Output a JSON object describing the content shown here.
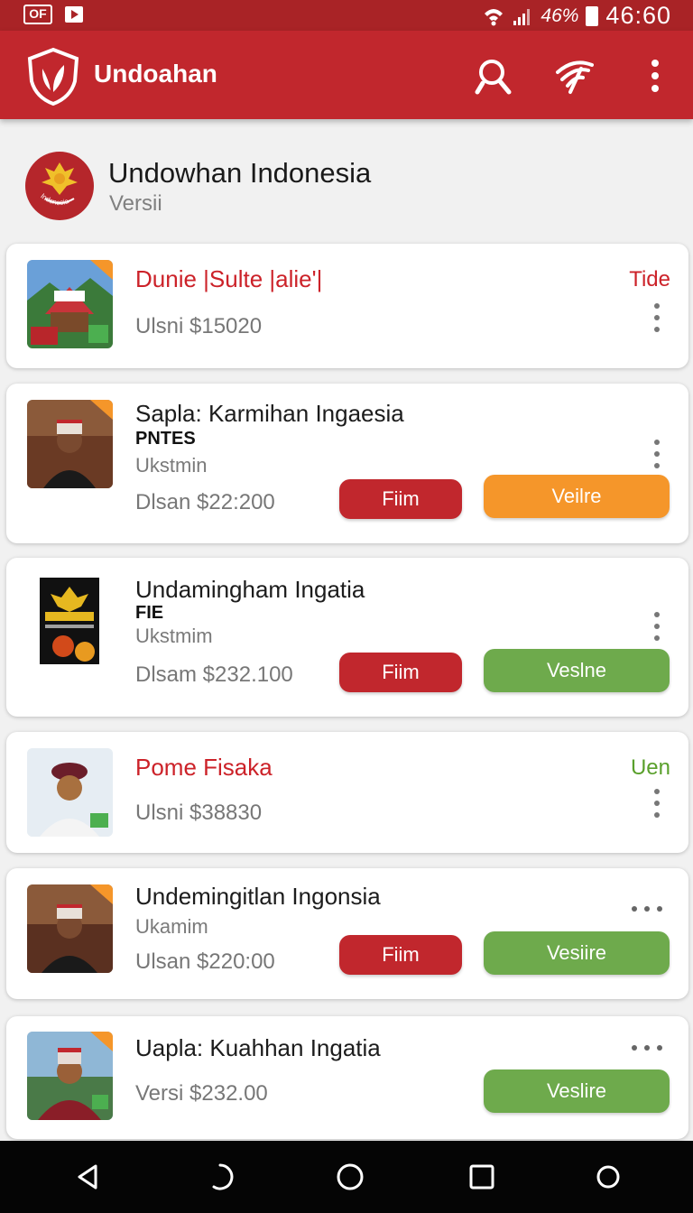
{
  "status_bar": {
    "left_box": "OF",
    "battery": "46%",
    "time": "46:60"
  },
  "app_bar": {
    "title": "Undoahan",
    "icons": [
      "shield-logo-icon",
      "search-icon",
      "wifi-icon",
      "more-vert-icon"
    ]
  },
  "profile": {
    "name": "Undowhan Indonesia",
    "subtitle": "Versii",
    "avatar_text": "Indonesia"
  },
  "cards": [
    {
      "title": "Dunie |Sulte |alie'|",
      "price": "Ulsni $15020",
      "tag": "Tide",
      "tag_color": "#cc2229"
    },
    {
      "title": "Sapla: Karmihan Ingaesia",
      "subtitle_bold": "PNTES",
      "subtitle": "Ukstmin",
      "price": "Dlsan $22:200",
      "button_primary": "Fiim",
      "button_secondary": "Veilre",
      "secondary_color": "#f5962a"
    },
    {
      "title": "Undamingham Ingatia",
      "subtitle_bold": "FIE",
      "subtitle": "Ukstmim",
      "price": "Dlsam $232.100",
      "button_primary": "Fiim",
      "button_secondary": "Veslne",
      "secondary_color": "#6eaa4c"
    },
    {
      "title": "Pome Fisaka",
      "price": "Ulsni $38830",
      "tag": "Uen",
      "tag_color": "#5aa02c"
    },
    {
      "title": "Undemingitlan Ingonsia",
      "subtitle": "Ukamim",
      "price": "Ulsan $220:00",
      "button_primary": "Fiim",
      "button_secondary": "Vesiire",
      "secondary_color": "#6eaa4c"
    },
    {
      "title": "Uapla: Kuahhan Ingatia",
      "price": "Versi $232.00",
      "button_secondary": "Veslire",
      "secondary_color": "#6eaa4c"
    }
  ],
  "nav_bar": {
    "icons": [
      "back-icon",
      "recent-icon",
      "home-icon",
      "overview-icon",
      "assistant-icon"
    ]
  },
  "colors": {
    "brand_red": "#c1272d",
    "status_red": "#a92326",
    "green": "#6eaa4c",
    "orange": "#f5962a"
  }
}
